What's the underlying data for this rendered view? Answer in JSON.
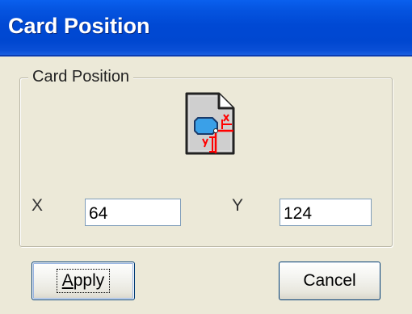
{
  "window": {
    "title": "Card Position"
  },
  "group": {
    "label": "Card Position",
    "icon": "card-position-icon"
  },
  "fields": {
    "x": {
      "label": "X",
      "value": "64"
    },
    "y": {
      "label": "Y",
      "value": "124"
    }
  },
  "buttons": {
    "apply": {
      "label_first": "A",
      "label_rest": "pply"
    },
    "cancel": {
      "label": "Cancel"
    }
  },
  "colors": {
    "titlebar": "#0047d0",
    "face": "#ece9d8",
    "marker": "#ff0000",
    "card_shape": "#3aa0e8"
  }
}
